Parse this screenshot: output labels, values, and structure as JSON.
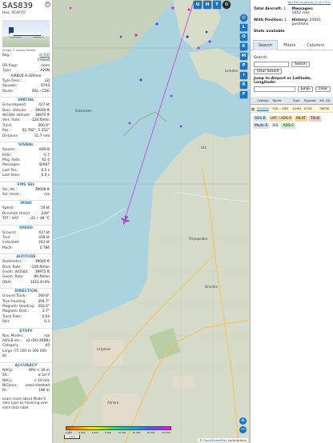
{
  "aircraft": {
    "callsign": "SAS839",
    "hex_line": "Hex: 4CAFC0",
    "photo_credit": "Image © Laszlo Fekete",
    "details": [
      {
        "k": "Reg.:",
        "v": "EI-SIH",
        "link": true
      },
      {
        "k": "",
        "v": "Ireland",
        "link": false
      },
      {
        "k": "DB flags:",
        "v": "none",
        "link": false
      },
      {
        "k": "Type:",
        "v": "A20N",
        "link": false
      },
      {
        "k": "",
        "v": "AIRBUS A-320neo",
        "link": false,
        "center": true
      },
      {
        "k": "Type Desc.:",
        "v": "L2J",
        "link": false
      },
      {
        "k": "Squawk:",
        "v": "0743",
        "link": false
      },
      {
        "k": "Route:",
        "v": "OSL - CDG",
        "link": false
      }
    ]
  },
  "sections": [
    {
      "title": "SPATIAL",
      "rows": [
        {
          "k": "Groundspeed:",
          "v": "417 kt"
        },
        {
          "k": "Baro. altitude:",
          "v": "39000 ft"
        },
        {
          "k": "WGS84 altitude:",
          "v": "38975 ft"
        },
        {
          "k": "Vert. Rate:",
          "v": "-128 ft/min"
        },
        {
          "k": "Track:",
          "v": "200.0°"
        },
        {
          "k": "Pos.:",
          "v": "52.702°, 5.552°"
        },
        {
          "k": "Distance:",
          "v": "31.7 nmi"
        }
      ]
    },
    {
      "title": "SIGNAL",
      "rows": [
        {
          "k": "Source:",
          "v": "ADS-B"
        },
        {
          "k": "RSSI:",
          "v": "-5.7"
        },
        {
          "k": "Msg. Rate:",
          "v": "62.4"
        },
        {
          "k": "Messages:",
          "v": "42067"
        },
        {
          "k": "Last Pos.:",
          "v": "0.5 s"
        },
        {
          "k": "Last Seen:",
          "v": "0.5 s"
        }
      ]
    },
    {
      "title": "FMS SEL",
      "rows": [
        {
          "k": "Sel. Alt.:",
          "v": "39008 ft"
        },
        {
          "k": "Sel. Head.:",
          "v": "n/a"
        }
      ]
    },
    {
      "title": "WIND",
      "rows": [
        {
          "k": "Speed:",
          "v": "54 kt"
        },
        {
          "k": "Direction (from):",
          "v": "244°"
        },
        {
          "k": "TAT / OAT:",
          "v": "-21 / -48 °C"
        }
      ]
    },
    {
      "title": "SPEED",
      "rows": [
        {
          "k": "Ground:",
          "v": "417 kt"
        },
        {
          "k": "True:",
          "v": "458 kt"
        },
        {
          "k": "Indicated:",
          "v": "243 kt"
        },
        {
          "k": "Mach:",
          "v": "0.784"
        }
      ]
    },
    {
      "title": "ALTITUDE",
      "rows": [
        {
          "k": "Barometric:",
          "v": "39000 ft"
        },
        {
          "k": "Baro. Rate:",
          "v": "-128 ft/min"
        },
        {
          "k": "Geom. WGS84:",
          "v": "38975 ft"
        },
        {
          "k": "Geom. Rate:",
          "v": "-96 ft/min"
        },
        {
          "k": "QNH:",
          "v": "1012.8 hPa"
        }
      ]
    },
    {
      "title": "DIRECTION",
      "rows": [
        {
          "k": "Ground Track:",
          "v": "200.0°"
        },
        {
          "k": "True Heading:",
          "v": "204.7°"
        },
        {
          "k": "Magnetic Heading:",
          "v": "202.0°"
        },
        {
          "k": "Magnetic Decl.:",
          "v": "2.7°"
        },
        {
          "k": "Track Rate:",
          "v": "0.03"
        },
        {
          "k": "Roll:",
          "v": "0.3"
        }
      ]
    },
    {
      "title": "STUFF",
      "rows": [
        {
          "k": "Nav. Modes:",
          "v": "n/a"
        },
        {
          "k": "ADS-B Ver.:",
          "v": "v2 (DO-260B)"
        },
        {
          "k": "Category:",
          "v": "A3"
        },
        {
          "k": "Large (75 000 to 300 000 lb)",
          "v": ""
        }
      ]
    },
    {
      "title": "ACCURACY",
      "rows": [
        {
          "k": "NACp:",
          "v": "EPU < 30 m"
        },
        {
          "k": "SIL:",
          "v": "≤ 1e-7"
        },
        {
          "k": "NACv:",
          "v": "< 10 m/s"
        },
        {
          "k": "NICbaro:",
          "v": "cross-checked"
        },
        {
          "k": "Rc:",
          "v": "186 m"
        }
      ]
    }
  ],
  "footer_note": "Learn more about Mode S data type by hovering over each data label.",
  "map": {
    "top_buttons": [
      "U",
      "H",
      "T"
    ],
    "side_buttons": [
      "L",
      "O",
      "K",
      "M",
      "P",
      "I",
      "R",
      "F"
    ],
    "zoom_in": "+",
    "zoom_out": "−",
    "scale": "2 km",
    "altitude_ticks": [
      "2 000",
      "4 000",
      "6 000",
      "8 000",
      "10 000",
      "20 000",
      "30 000",
      "40 000+"
    ],
    "attribution_prefix": "©",
    "attribution_link": "OpenStreetMap",
    "attribution_suffix": "contributors",
    "town_labels": [
      "Lelystad",
      "Flevopolder",
      "Almere",
      "Enkhuizen",
      "Lemmer",
      "Urk",
      "Dronten"
    ]
  },
  "sidebar": {
    "version": "tar1090 on github (3.14.1702)",
    "stats": [
      {
        "label": "Total Aircraft:",
        "value": "1"
      },
      {
        "label": "Messages:",
        "value": "1652 /sec"
      },
      {
        "label": "With Position:",
        "value": "1"
      },
      {
        "label": "History:",
        "value": "23661 positions"
      }
    ],
    "stats_note": "Stats available",
    "tabs": [
      "Search",
      "Filters",
      "Columns"
    ],
    "search_label": "Search:",
    "search_button": "Search",
    "clear_search": "Clear Search",
    "jump_label": "Jump to Airport or Latitude, Longitude:",
    "jump_button": "Jump",
    "clear_button": "Clear",
    "table_headers": [
      "Callsign",
      "Route",
      "Type",
      "Squawk",
      "Alt. (ft)"
    ],
    "table_row": [
      "SAS839",
      "OSL - CDG",
      "A20N",
      "0743",
      "39000"
    ],
    "legend": [
      {
        "label": "ADS-B",
        "color": "#cfe6ff"
      },
      {
        "label": "UAT / ADS-R",
        "color": "#ffe0a8"
      },
      {
        "label": "MLAT",
        "color": "#ffd494"
      },
      {
        "label": "TIS-B",
        "color": "#ffc3c3"
      },
      {
        "label": "Mode-S",
        "color": "#d9e1ec"
      },
      {
        "label": "AIS",
        "color": "#ffffff"
      },
      {
        "label": "ADS-C",
        "color": "#c8f0c8"
      }
    ]
  }
}
